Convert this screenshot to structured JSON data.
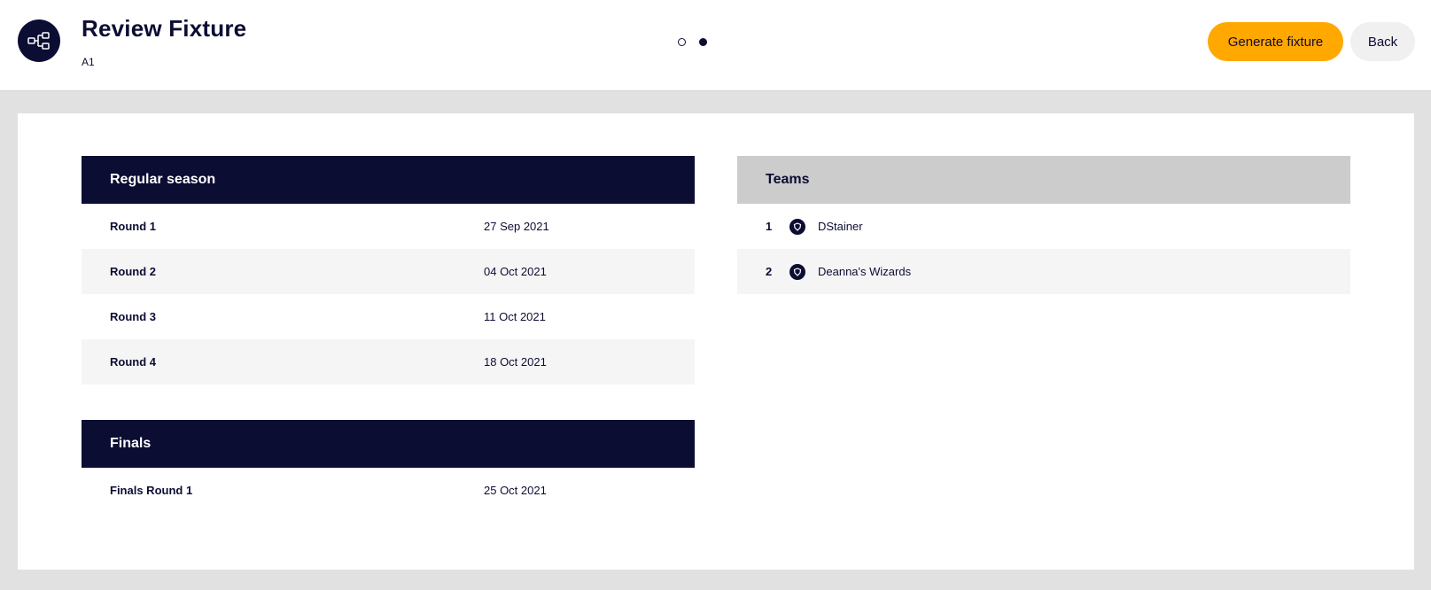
{
  "header": {
    "title": "Review Fixture",
    "subtitle": "A1",
    "logo_icon": "fixture-tree-icon",
    "steps": {
      "total": 2,
      "current": 2
    },
    "generate_label": "Generate fixture",
    "back_label": "Back"
  },
  "regular_season": {
    "title": "Regular season",
    "rounds": [
      {
        "label": "Round 1",
        "date": "27 Sep 2021"
      },
      {
        "label": "Round 2",
        "date": "04 Oct 2021"
      },
      {
        "label": "Round 3",
        "date": "11 Oct 2021"
      },
      {
        "label": "Round 4",
        "date": "18 Oct 2021"
      }
    ]
  },
  "finals": {
    "title": "Finals",
    "rounds": [
      {
        "label": "Finals Round 1",
        "date": "25 Oct 2021"
      }
    ]
  },
  "teams": {
    "title": "Teams",
    "items": [
      {
        "number": "1",
        "name": "DStainer",
        "icon": "team-badge-icon"
      },
      {
        "number": "2",
        "name": "Deanna's Wizards",
        "icon": "team-badge-icon"
      }
    ]
  },
  "colors": {
    "navy": "#0c0d33",
    "accent": "#ffa800",
    "background": "#e1e1e1"
  }
}
